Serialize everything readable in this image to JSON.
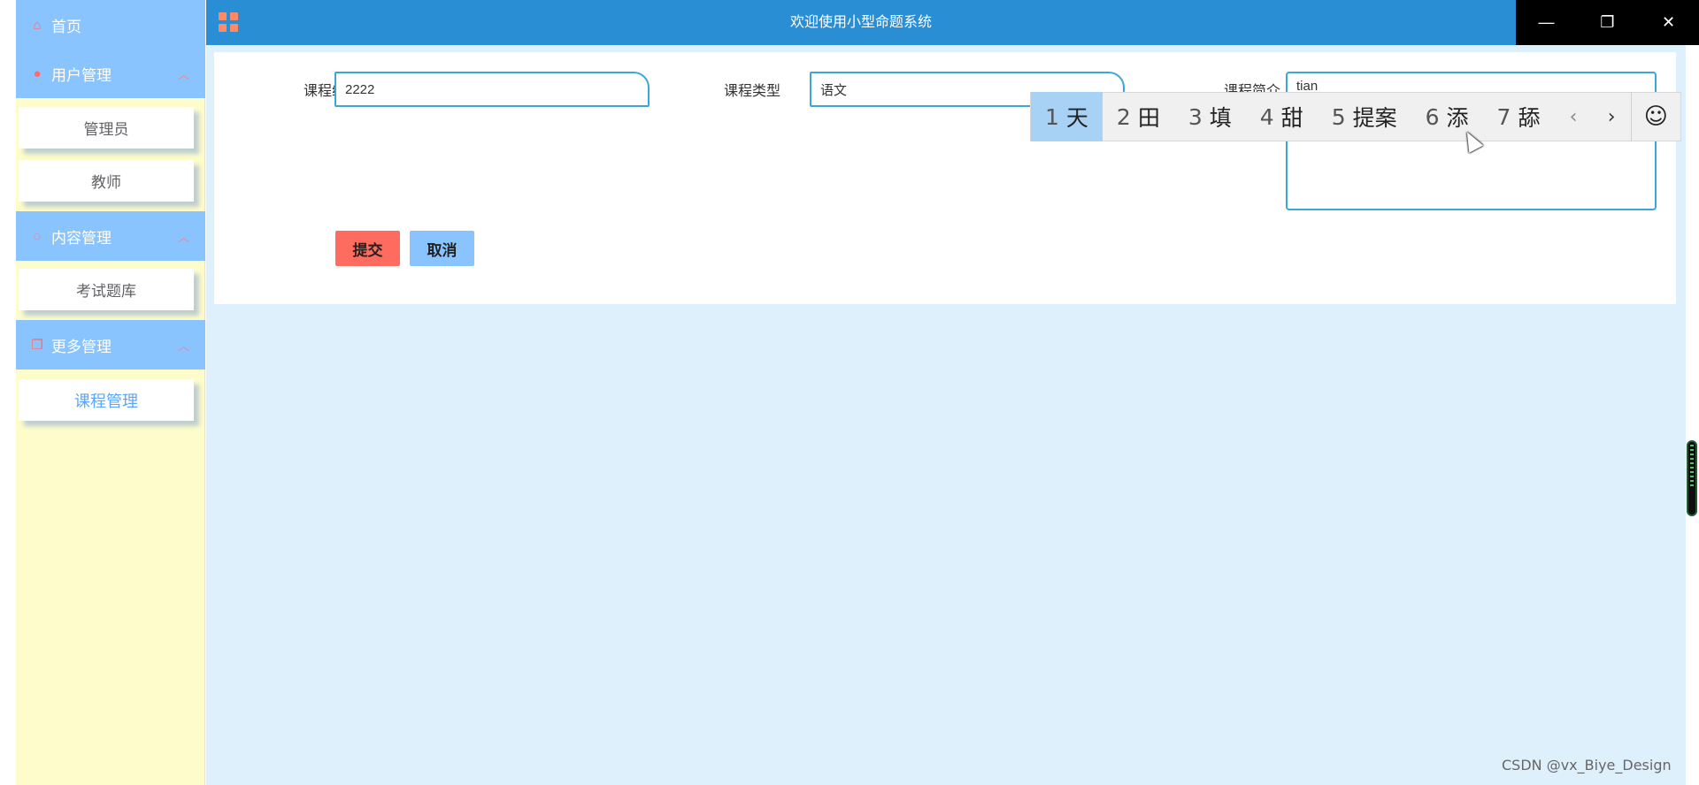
{
  "window": {
    "title": "欢迎使用小型命题系统",
    "controls": {
      "minimize": "—",
      "restore": "❐",
      "close": "✕"
    }
  },
  "sidebar": {
    "home": {
      "label": "首页",
      "icon": "home-icon"
    },
    "groups": [
      {
        "label": "用户管理",
        "icon": "user-icon",
        "items": [
          "管理员",
          "教师"
        ]
      },
      {
        "label": "内容管理",
        "icon": "chat-icon",
        "items": [
          "考试题库"
        ]
      },
      {
        "label": "更多管理",
        "icon": "copy-icon",
        "items": [
          "课程管理"
        ]
      }
    ],
    "active_item": "课程管理"
  },
  "form": {
    "course_no": {
      "label": "课程编号",
      "value": "2222"
    },
    "course_type": {
      "label": "课程类型",
      "value": "语文"
    },
    "course_intro": {
      "label": "课程简介",
      "value": "tian"
    },
    "submit_label": "提交",
    "cancel_label": "取消"
  },
  "ime": {
    "candidates": [
      {
        "num": "1",
        "text": "天"
      },
      {
        "num": "2",
        "text": "田"
      },
      {
        "num": "3",
        "text": "填"
      },
      {
        "num": "4",
        "text": "甜"
      },
      {
        "num": "5",
        "text": "提案"
      },
      {
        "num": "6",
        "text": "添"
      },
      {
        "num": "7",
        "text": "舔"
      }
    ],
    "prev": "‹",
    "next": "›",
    "emoji": "☺"
  },
  "watermark": "CSDN @vx_Biye_Design",
  "colors": {
    "sidebar_bg": "#fffccb",
    "menu_head_bg": "#8ac4ff",
    "titlebar_bg": "#2a8ed4",
    "content_bg": "#dff0fd",
    "submit_bg": "#ff6b5f",
    "cancel_bg": "#8ac4ff",
    "accent_border": "#3ba7d8"
  }
}
